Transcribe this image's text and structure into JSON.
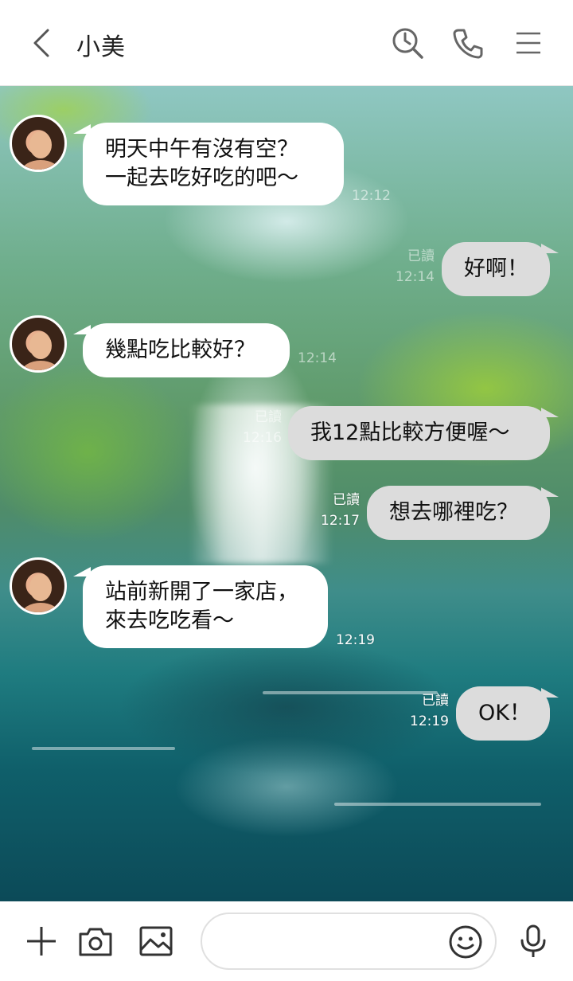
{
  "header": {
    "contact_name": "小美"
  },
  "messages": [
    {
      "side": "in",
      "text_line1": "明天中午有沒有空？",
      "text_line2": "一起去吃好吃的吧～",
      "time": "12:12"
    },
    {
      "side": "out",
      "text": "好啊！",
      "read": "已讀",
      "time": "12:14"
    },
    {
      "side": "in",
      "text": "幾點吃比較好？",
      "time": "12:14"
    },
    {
      "side": "out",
      "text": "我12點比較方便喔～",
      "read": "已讀",
      "time": "12:16"
    },
    {
      "side": "out",
      "text": "想去哪裡吃？",
      "read": "已讀",
      "time": "12:17"
    },
    {
      "side": "in",
      "text_line1": "站前新開了一家店，",
      "text_line2": "來去吃吃看～",
      "time": "12:19"
    },
    {
      "side": "out",
      "text": "OK！",
      "read": "已讀",
      "time": "12:19"
    }
  ],
  "composer": {
    "placeholder": ""
  },
  "icons": {
    "back": "chevron-left-icon",
    "history": "search-clock-icon",
    "call": "phone-icon",
    "menu": "hamburger-menu-icon",
    "add": "plus-icon",
    "camera": "camera-icon",
    "image": "image-icon",
    "emoji": "smiley-icon",
    "voice": "microphone-icon"
  }
}
